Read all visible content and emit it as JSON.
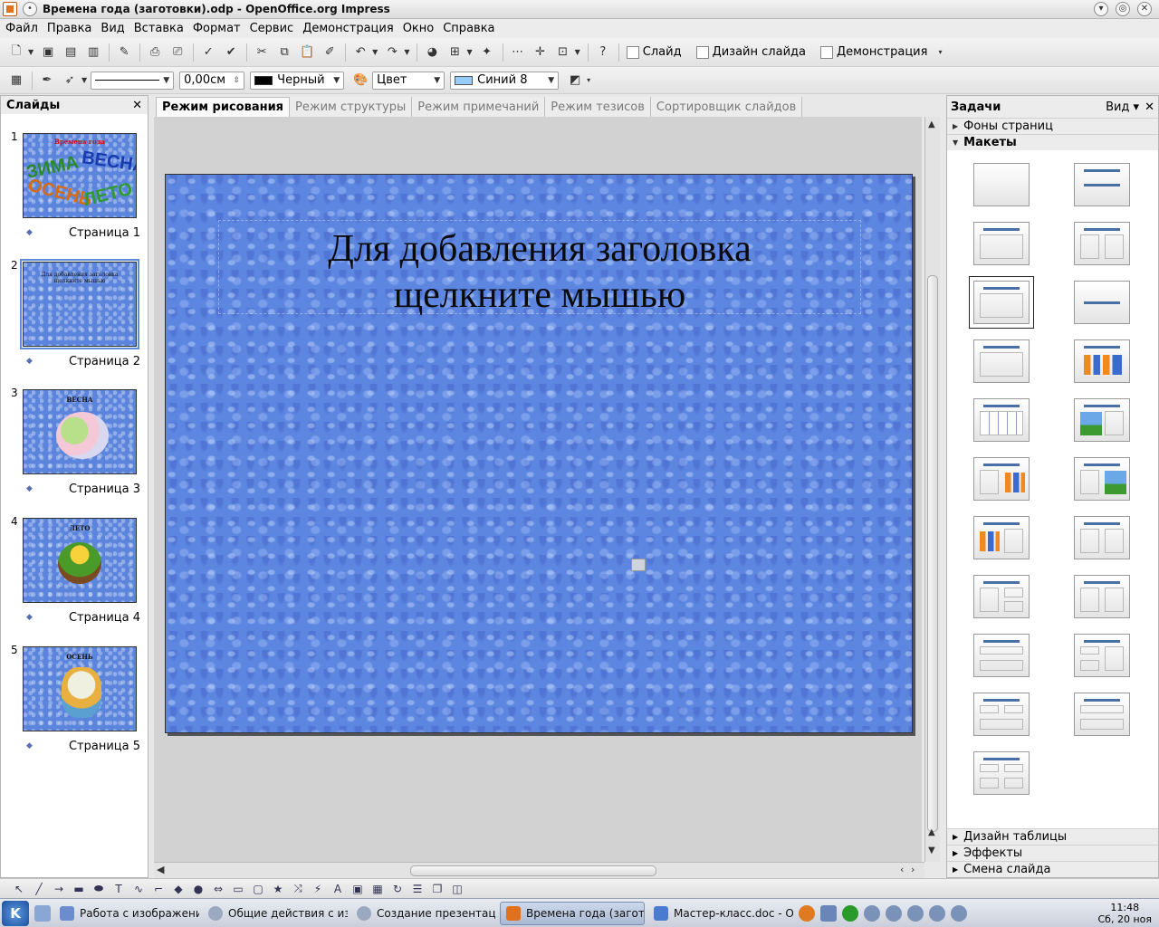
{
  "window": {
    "title": "Времена года (заготовки).odp - OpenOffice.org Impress"
  },
  "menu": [
    "Файл",
    "Правка",
    "Вид",
    "Вставка",
    "Формат",
    "Сервис",
    "Демонстрация",
    "Окно",
    "Справка"
  ],
  "toolbar": {
    "slide_label": "Слайд",
    "design_label": "Дизайн слайда",
    "show_label": "Демонстрация",
    "line_width": "0,00см",
    "line_color": "Черный",
    "line_color_hex": "#000000",
    "fill_type": "Цвет",
    "fill_color": "Синий 8",
    "fill_color_hex": "#99ccff"
  },
  "slides_panel": {
    "title": "Слайды",
    "slides": [
      {
        "num": "1",
        "caption": "Страница 1",
        "title": "Времена года",
        "words": [
          "ЗИМА",
          "ВЕСНА",
          "ОСЕНЬ",
          "ЛЕТО"
        ]
      },
      {
        "num": "2",
        "caption": "Страница 2",
        "title": "Для добавления заголовка щелкните мышью"
      },
      {
        "num": "3",
        "caption": "Страница 3",
        "title": "ВЕСНА"
      },
      {
        "num": "4",
        "caption": "Страница 4",
        "title": "ЛЕТО"
      },
      {
        "num": "5",
        "caption": "Страница 5",
        "title": "ОСЕНЬ"
      }
    ]
  },
  "tabs": [
    "Режим рисования",
    "Режим структуры",
    "Режим примечаний",
    "Режим тезисов",
    "Сортировщик слайдов"
  ],
  "slide": {
    "title_placeholder": "Для добавления заголовка щелкните мышью"
  },
  "tasks_panel": {
    "title": "Задачи",
    "view_label": "Вид",
    "sections_top": [
      "Фоны страниц",
      "Макеты"
    ],
    "sections_bottom": [
      "Дизайн таблицы",
      "Эффекты",
      "Смена слайда"
    ]
  },
  "taskbar": {
    "tasks": [
      "Работа с изображени",
      "Общие действия с изо",
      "Создание презентац",
      "Времена года (загото",
      "Мастер-класс.doc - Op"
    ],
    "clock_time": "11:48",
    "clock_date": "Сб, 20 ноя"
  }
}
